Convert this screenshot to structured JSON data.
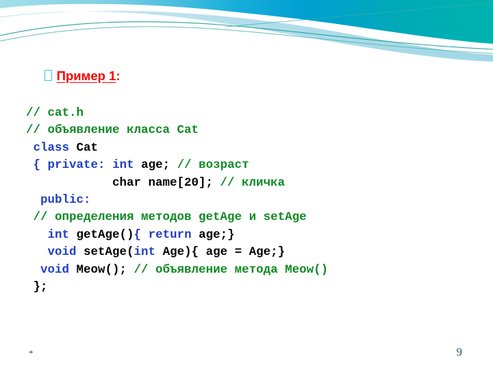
{
  "slide": {
    "title": {
      "bullet_icon": "square-bullet-icon",
      "text": "Пример 1",
      "suffix": ":"
    },
    "code_lines": [
      {
        "name": "code-line-comment-filename",
        "indent": 0,
        "tokens": [
          {
            "t": "// cat.h",
            "c": "cm"
          }
        ]
      },
      {
        "name": "code-line-comment-class-declaration",
        "indent": 0,
        "tokens": [
          {
            "t": "// объявление класса Cat",
            "c": "cm"
          }
        ]
      },
      {
        "name": "code-line-class-cat",
        "indent": 0,
        "tokens": [
          {
            "t": " ",
            "c": "pl"
          },
          {
            "t": "class",
            "c": "kw"
          },
          {
            "t": " Cat",
            "c": "pl"
          }
        ]
      },
      {
        "name": "code-line-private-age",
        "indent": 0,
        "tokens": [
          {
            "t": " ",
            "c": "pl"
          },
          {
            "t": "{ private:",
            "c": "kw"
          },
          {
            "t": " ",
            "c": "pl"
          },
          {
            "t": "int",
            "c": "kw"
          },
          {
            "t": " age; ",
            "c": "pl"
          },
          {
            "t": "// возраст",
            "c": "cm"
          }
        ]
      },
      {
        "name": "code-line-char-name",
        "indent": 0,
        "tokens": [
          {
            "t": "            char name[20]; ",
            "c": "pl"
          },
          {
            "t": "// кличка",
            "c": "cm"
          }
        ]
      },
      {
        "name": "code-line-public",
        "indent": 0,
        "tokens": [
          {
            "t": "  ",
            "c": "pl"
          },
          {
            "t": "public:",
            "c": "kw"
          }
        ]
      },
      {
        "name": "code-line-comment-methods",
        "indent": 0,
        "tokens": [
          {
            "t": " ",
            "c": "pl"
          },
          {
            "t": "// определения методов getAge и setAge",
            "c": "cm"
          }
        ]
      },
      {
        "name": "code-line-getage",
        "indent": 0,
        "tokens": [
          {
            "t": "   ",
            "c": "pl"
          },
          {
            "t": "int",
            "c": "kw"
          },
          {
            "t": " getAge()",
            "c": "pl"
          },
          {
            "t": "{",
            "c": "kw"
          },
          {
            "t": " ",
            "c": "pl"
          },
          {
            "t": "return",
            "c": "kw"
          },
          {
            "t": " age;}",
            "c": "pl"
          }
        ]
      },
      {
        "name": "code-line-setage",
        "indent": 0,
        "tokens": [
          {
            "t": "   ",
            "c": "pl"
          },
          {
            "t": "void",
            "c": "kw"
          },
          {
            "t": " setAge(",
            "c": "pl"
          },
          {
            "t": "int",
            "c": "kw"
          },
          {
            "t": " Age){ age = Age;}",
            "c": "pl"
          }
        ]
      },
      {
        "name": "code-line-meow",
        "indent": 0,
        "tokens": [
          {
            "t": "  ",
            "c": "pl"
          },
          {
            "t": "void",
            "c": "kw"
          },
          {
            "t": " Meow(); ",
            "c": "pl"
          },
          {
            "t": "// объявление метода Meow()",
            "c": "cm"
          }
        ]
      },
      {
        "name": "code-line-close-brace",
        "indent": 0,
        "tokens": [
          {
            "t": " };",
            "c": "pl"
          }
        ]
      }
    ],
    "footer": {
      "left_marker": "*",
      "page_number": "9"
    },
    "colors": {
      "comment_green": "#0f8a23",
      "keyword_blue": "#1f3fbf",
      "plain_black": "#000000",
      "title_red": "#ff0000",
      "bullet_teal": "#3fc7d4",
      "footer_teal": "#2f5564",
      "wave_deep_cyan": "#00a8d6",
      "wave_light_cyan": "#9fd9e8",
      "wave_pale_cyan": "#bfe4ef",
      "wave_line_teal": "#1f9e9a"
    }
  }
}
